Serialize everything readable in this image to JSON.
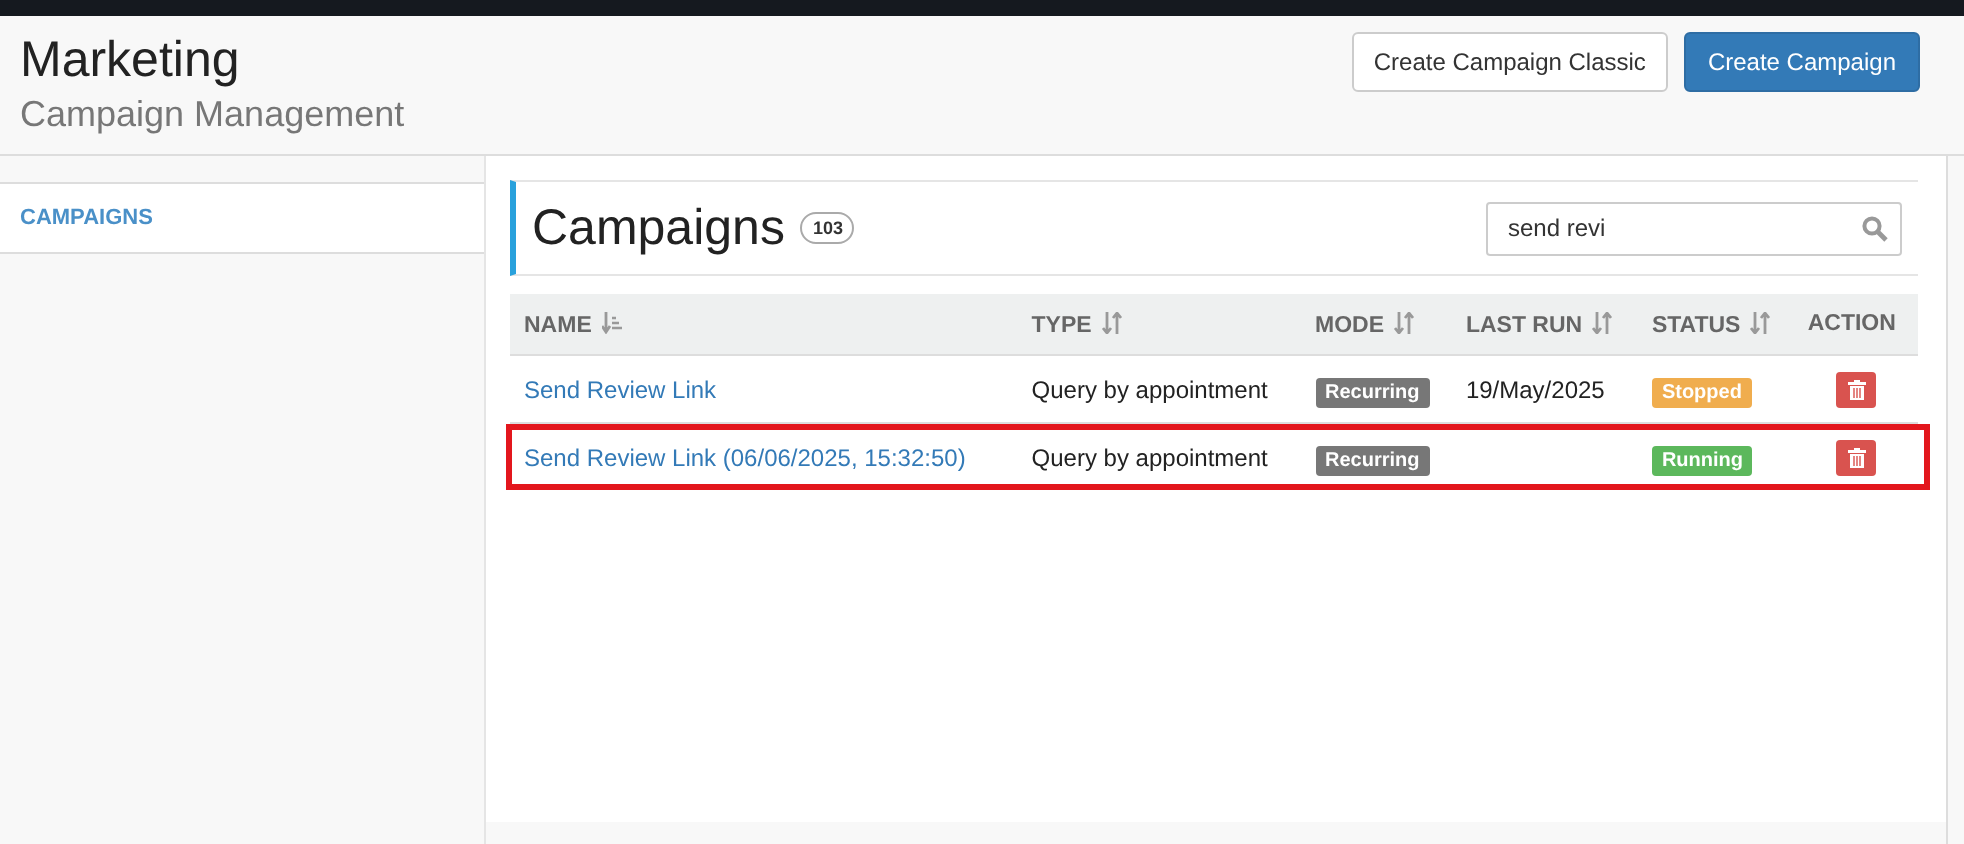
{
  "header": {
    "title": "Marketing",
    "subtitle": "Campaign Management",
    "buttons": [
      {
        "label": "Create Campaign Classic",
        "kind": "default"
      },
      {
        "label": "Create Campaign",
        "kind": "primary"
      }
    ]
  },
  "sidebar": {
    "items": [
      {
        "label": "CAMPAIGNS",
        "selected": true
      }
    ]
  },
  "panel": {
    "title": "Campaigns",
    "count": "103",
    "search": {
      "value": "send revi"
    }
  },
  "table": {
    "columns": [
      {
        "label": "NAME",
        "kind": "sorted"
      },
      {
        "label": "TYPE",
        "kind": "sortable"
      },
      {
        "label": "MODE",
        "kind": "sortable"
      },
      {
        "label": "LAST RUN",
        "kind": "sortable"
      },
      {
        "label": "STATUS",
        "kind": "sortable"
      },
      {
        "label": "ACTION",
        "kind": "plain"
      }
    ],
    "rows": [
      {
        "name": "Send Review Link",
        "type": "Query by appointment",
        "mode": "Recurring",
        "last_run": "19/May/2025",
        "status": "Stopped",
        "color": "#f0ad4e",
        "highlighted": false
      },
      {
        "name": "Send Review Link (06/06/2025, 15:32:50)",
        "type": "Query by appointment",
        "mode": "Recurring",
        "status": "Running",
        "color": "#5cb85c",
        "highlighted": true
      }
    ]
  }
}
